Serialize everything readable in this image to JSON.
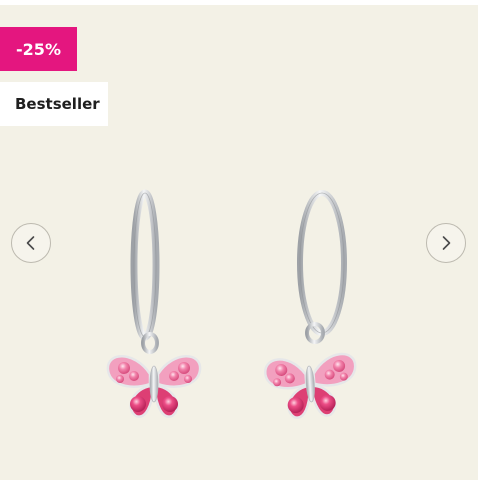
{
  "badges": {
    "discount_label": "-25%",
    "bestseller_label": "Bestseller"
  },
  "gallery": {
    "prev_icon": "chevron-left-icon",
    "next_icon": "chevron-right-icon",
    "product_image": "butterfly-hoop-earrings"
  },
  "colors": {
    "background": "#f3f1e6",
    "discount_badge": "#e4167f",
    "silver": "#c7c9cc",
    "pink_light": "#f7a8c6",
    "pink_dark": "#d8346b"
  }
}
